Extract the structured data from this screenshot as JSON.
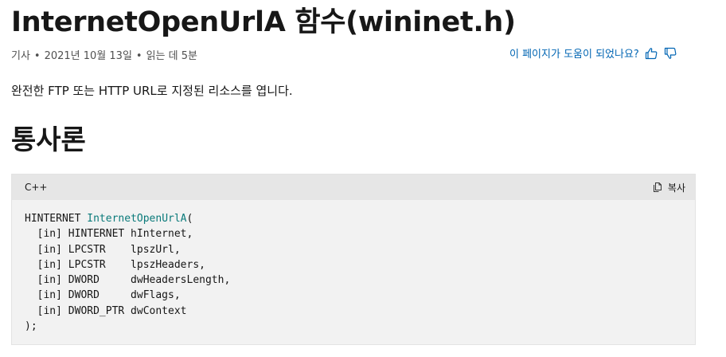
{
  "article": {
    "title": "InternetOpenUrlA 함수(wininet.h)",
    "meta": {
      "type": "기사",
      "date": "2021년 10월 13일",
      "read_time": "읽는 데 5분"
    },
    "feedback": {
      "question": "이 페이지가 도움이 되었나요?",
      "like_icon": "thumbs-up-icon",
      "dislike_icon": "thumbs-down-icon"
    },
    "summary": "완전한 FTP 또는 HTTP URL로 지정된 리소스를 엽니다.",
    "syntax_heading": "통사론"
  },
  "code_block": {
    "language": "C++",
    "copy_label": "복사",
    "copy_icon": "copy-icon",
    "lines": [
      {
        "pre": "HINTERNET ",
        "fn": "InternetOpenUrlA",
        "post": "("
      },
      {
        "pre": "  [in] HINTERNET hInternet,",
        "fn": "",
        "post": ""
      },
      {
        "pre": "  [in] LPCSTR    lpszUrl,",
        "fn": "",
        "post": ""
      },
      {
        "pre": "  [in] LPCSTR    lpszHeaders,",
        "fn": "",
        "post": ""
      },
      {
        "pre": "  [in] DWORD     dwHeadersLength,",
        "fn": "",
        "post": ""
      },
      {
        "pre": "  [in] DWORD     dwFlags,",
        "fn": "",
        "post": ""
      },
      {
        "pre": "  [in] DWORD_PTR dwContext",
        "fn": "",
        "post": ""
      },
      {
        "pre": ");",
        "fn": "",
        "post": ""
      }
    ]
  },
  "colors": {
    "link": "#0065b3",
    "function_name": "#0a7a7a",
    "code_background": "#f2f2f2",
    "code_header": "#e6e6e6"
  }
}
